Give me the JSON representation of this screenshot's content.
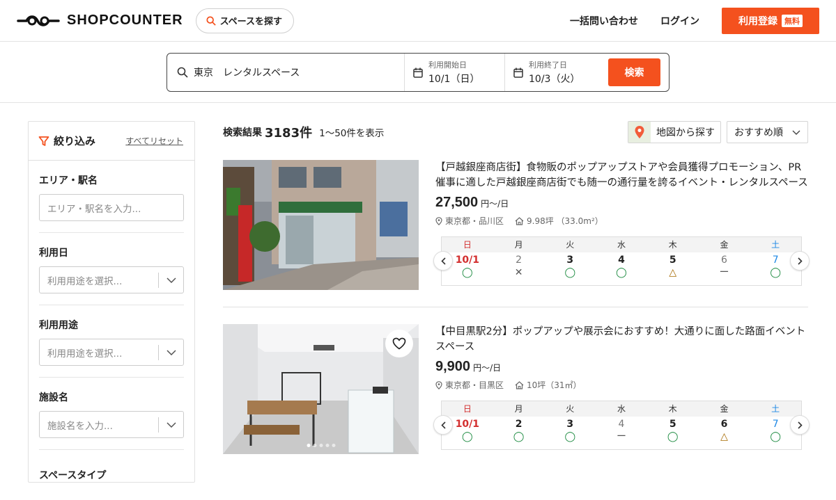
{
  "header": {
    "brand": "SHOPCOUNTER",
    "find_space": "スペースを探す",
    "bulk_inquiry": "一括問い合わせ",
    "login": "ログイン",
    "signup": "利用登録",
    "signup_badge": "無料"
  },
  "search": {
    "query": "東京　レンタルスペース",
    "start_label": "利用開始日",
    "start_value": "10/1（日）",
    "end_label": "利用終了日",
    "end_value": "10/3（火）",
    "button": "検索"
  },
  "sidebar": {
    "title": "絞り込み",
    "reset": "すべてリセット",
    "area_label": "エリア・駅名",
    "area_placeholder": "エリア・駅名を入力...",
    "date_label": "利用日",
    "date_placeholder": "利用用途を選択...",
    "purpose_label": "利用用途",
    "purpose_placeholder": "利用用途を選択...",
    "facility_label": "施設名",
    "facility_placeholder": "施設名を入力...",
    "space_type_label": "スペースタイプ"
  },
  "results": {
    "label": "検索結果",
    "count": "3183件",
    "range": "1〜50件を表示",
    "map_button": "地図から探す",
    "sort": "おすすめ順"
  },
  "weekdays": [
    "日",
    "月",
    "火",
    "水",
    "木",
    "金",
    "土"
  ],
  "listings": [
    {
      "title": "【戸越銀座商店街】食物販のポップアップストアや会員獲得プロモーション、PR催事に適した戸越銀座商店街でも随一の通行量を誇るイベント・レンタルスペース",
      "price": "27,500",
      "unit": "円〜/日",
      "location": "東京都・品川区",
      "size": "9.98坪 （33.0m²）",
      "days": [
        "10/1",
        "2",
        "3",
        "4",
        "5",
        "6",
        "7"
      ],
      "status": [
        "◯",
        "✕",
        "◯",
        "◯",
        "△",
        "ー",
        "◯"
      ]
    },
    {
      "title": "【中目黒駅2分】ポップアップや展示会におすすめ！大通りに面した路面イベントスペース",
      "price": "9,900",
      "unit": "円〜/日",
      "location": "東京都・目黒区",
      "size": "10坪（31㎡）",
      "days": [
        "10/1",
        "2",
        "3",
        "4",
        "5",
        "6",
        "7"
      ],
      "status": [
        "◯",
        "◯",
        "◯",
        "ー",
        "◯",
        "△",
        "◯"
      ]
    }
  ],
  "colors": {
    "accent": "#f4511e",
    "available": "#1b8a3f",
    "sunday": "#d32f2f",
    "saturday": "#1e88e5"
  }
}
